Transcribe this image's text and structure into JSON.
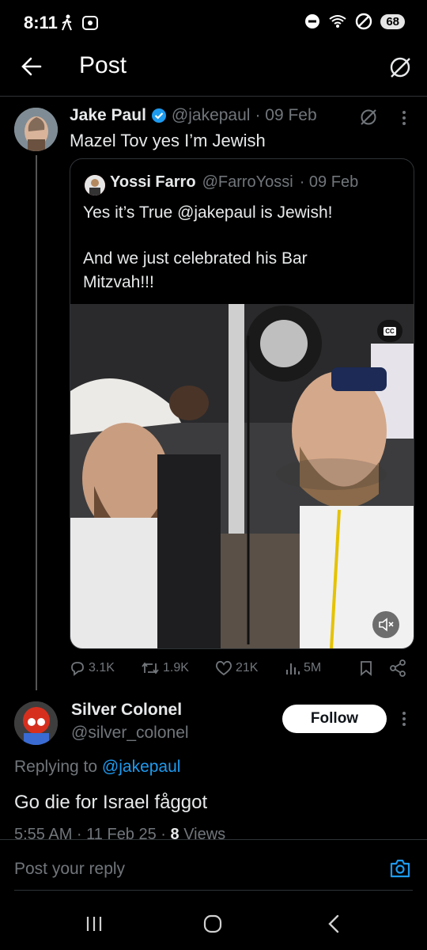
{
  "status_bar": {
    "time": "8:11",
    "battery": "68"
  },
  "header": {
    "title": "Post"
  },
  "main_tweet": {
    "author_name": "Jake Paul",
    "author_handle": "@jakepaul",
    "date": "· 09 Feb",
    "text": "Mazel Tov yes I’m Jewish"
  },
  "quoted_tweet": {
    "author_name": "Yossi Farro",
    "author_handle": "@FarroYossi",
    "date": "· 09 Feb",
    "text_line1": "Yes it’s True @jakepaul is Jewish!",
    "text_line2": "And we just celebrated his Bar",
    "text_line3": "Mitzvah!!!",
    "cc_label": "cc"
  },
  "actions": {
    "replies": "3.1K",
    "reposts": "1.9K",
    "likes": "21K",
    "views": "5M"
  },
  "reply": {
    "author_name": "Silver Colonel",
    "author_handle": "@silver_colonel",
    "follow_label": "Follow",
    "replying_prefix": "Replying to ",
    "replying_handle": "@jakepaul",
    "text": "Go die for Israel fåggot",
    "meta_time": "5:55 AM · 11 Feb 25 · ",
    "meta_views_count": "8",
    "meta_views_label": " Views"
  },
  "compose": {
    "placeholder": "Post your reply"
  },
  "colors": {
    "accent": "#1d9bf0",
    "muted": "#71767b",
    "background": "#000000"
  }
}
